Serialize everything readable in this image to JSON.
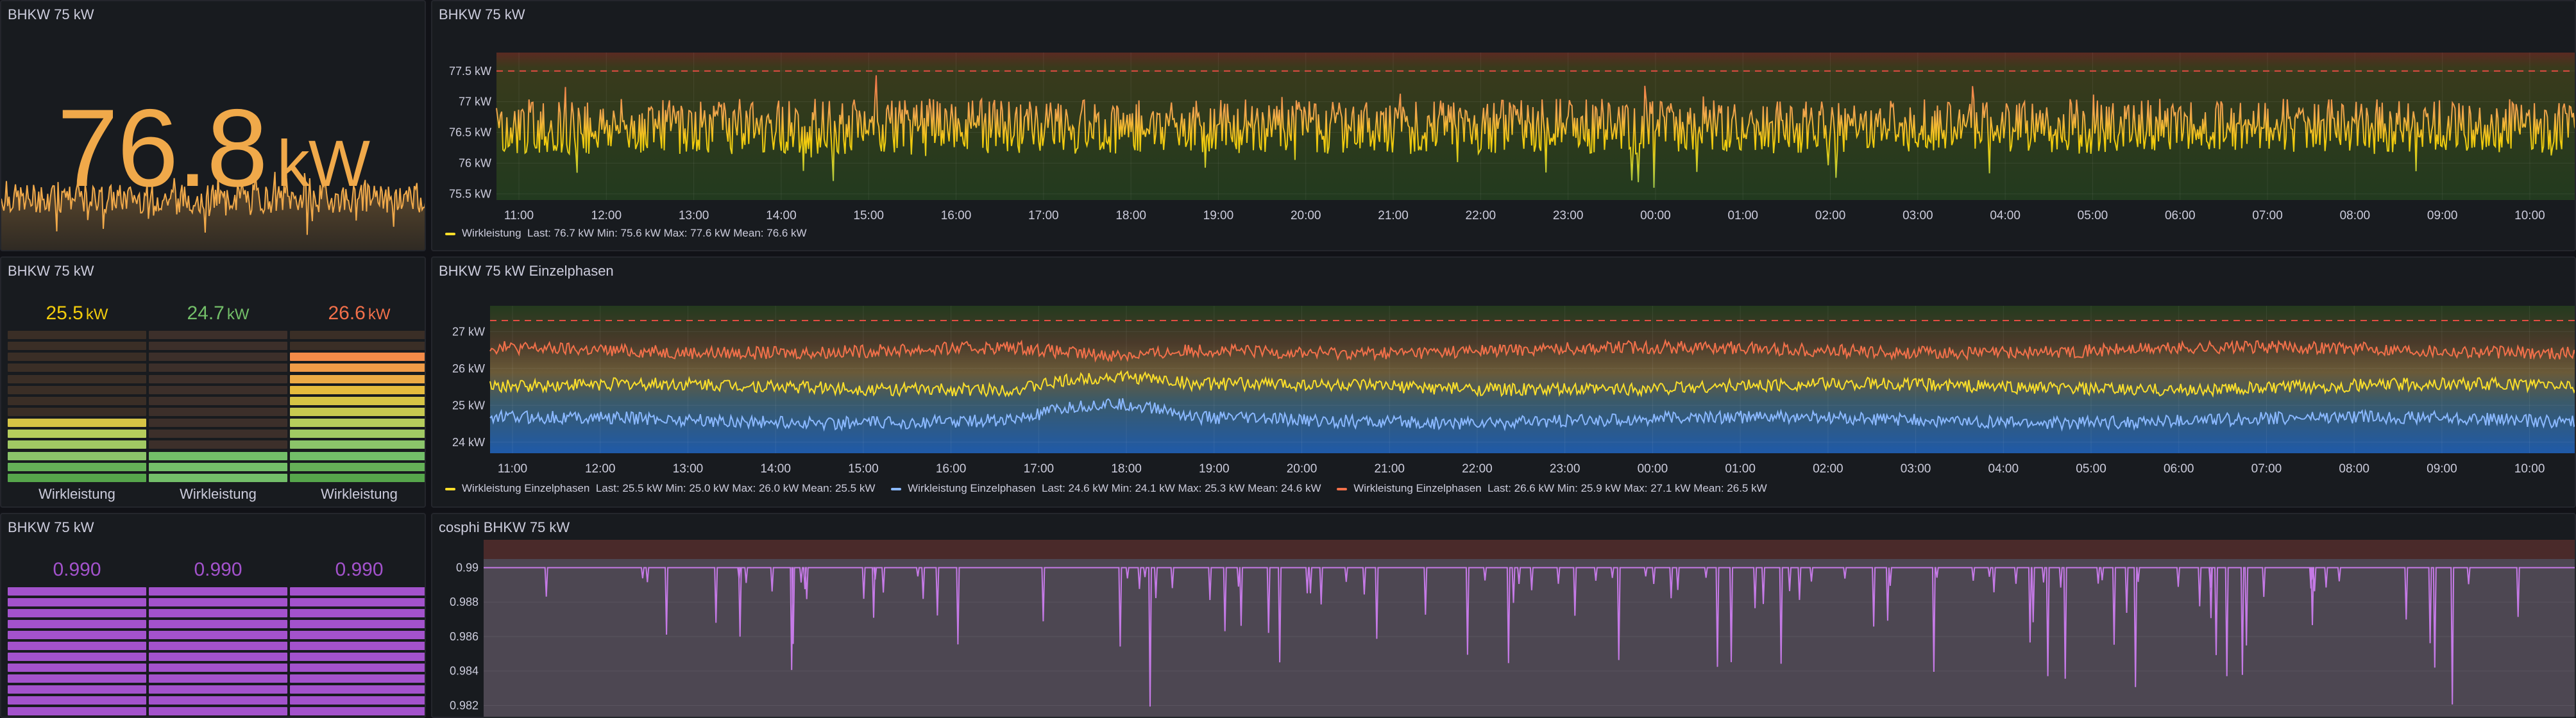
{
  "panels": {
    "stat": {
      "title": "BHKW 75 kW",
      "value": "76.8",
      "unit": "kW"
    },
    "power": {
      "title": "BHKW 75 kW",
      "y_ticks": [
        "77.5 kW",
        "77 kW",
        "76.5 kW",
        "76 kW",
        "75.5 kW"
      ],
      "x_ticks": [
        "11:00",
        "12:00",
        "13:00",
        "14:00",
        "15:00",
        "16:00",
        "17:00",
        "18:00",
        "19:00",
        "20:00",
        "21:00",
        "22:00",
        "23:00",
        "00:00",
        "01:00",
        "02:00",
        "03:00",
        "04:00",
        "05:00",
        "06:00",
        "07:00",
        "08:00",
        "09:00",
        "10:00"
      ],
      "legend": {
        "name": "Wirkleistung",
        "stats": "Last: 76.7 kW   Min: 75.6 kW   Max: 77.6 kW   Mean: 76.6 kW"
      }
    },
    "phases_bar": {
      "title": "BHKW 75 kW",
      "gauges": [
        {
          "value": "25.5",
          "unit": "kW",
          "label": "Wirkleistung",
          "color": "#f2cc0c"
        },
        {
          "value": "24.7",
          "unit": "kW",
          "label": "Wirkleistung",
          "color": "#73bf69"
        },
        {
          "value": "26.6",
          "unit": "kW",
          "label": "Wirkleistung",
          "color": "#f2704a"
        }
      ]
    },
    "phases": {
      "title": "BHKW 75 kW Einzelphasen",
      "y_ticks": [
        "27 kW",
        "26 kW",
        "25 kW",
        "24 kW"
      ],
      "x_ticks": [
        "11:00",
        "12:00",
        "13:00",
        "14:00",
        "15:00",
        "16:00",
        "17:00",
        "18:00",
        "19:00",
        "20:00",
        "21:00",
        "22:00",
        "23:00",
        "00:00",
        "01:00",
        "02:00",
        "03:00",
        "04:00",
        "05:00",
        "06:00",
        "07:00",
        "08:00",
        "09:00",
        "10:00"
      ],
      "legend": [
        {
          "name": "Wirkleistung Einzelphasen",
          "stats": "Last: 25.5 kW   Min: 25.0 kW   Max: 26.0 kW   Mean: 25.5 kW",
          "color": "#fade2a"
        },
        {
          "name": "Wirkleistung Einzelphasen",
          "stats": "Last: 24.6 kW   Min: 24.1 kW   Max: 25.3 kW   Mean: 24.6 kW",
          "color": "#8ab8ff"
        },
        {
          "name": "Wirkleistung Einzelphasen",
          "stats": "Last: 26.6 kW   Min: 25.9 kW   Max: 27.1 kW   Mean: 26.5 kW",
          "color": "#f2704a"
        }
      ]
    },
    "cosphi_bar": {
      "title": "BHKW 75 kW",
      "gauges": [
        {
          "value": "0.990",
          "color": "#a352cc"
        },
        {
          "value": "0.990",
          "color": "#a352cc"
        },
        {
          "value": "0.990",
          "color": "#a352cc"
        }
      ]
    },
    "cosphi": {
      "title": "cosphi BHKW 75 kW",
      "y_ticks": [
        "0.99",
        "0.988",
        "0.986",
        "0.984",
        "0.982"
      ]
    }
  },
  "chart_data": [
    {
      "type": "line",
      "title": "BHKW 75 kW",
      "series": [
        {
          "name": "Wirkleistung",
          "last": 76.7,
          "min": 75.6,
          "max": 77.6,
          "mean": 76.6
        }
      ],
      "ylim": [
        75.4,
        77.8
      ],
      "threshold": 77.5
    },
    {
      "type": "line",
      "title": "BHKW 75 kW Einzelphasen",
      "series": [
        {
          "name": "Wirkleistung Einzelphasen",
          "last": 25.5,
          "min": 25.0,
          "max": 26.0,
          "mean": 25.5
        },
        {
          "name": "Wirkleistung Einzelphasen",
          "last": 24.6,
          "min": 24.1,
          "max": 25.3,
          "mean": 24.6
        },
        {
          "name": "Wirkleistung Einzelphasen",
          "last": 26.6,
          "min": 25.9,
          "max": 27.1,
          "mean": 26.5
        }
      ],
      "ylim": [
        23.7,
        27.7
      ],
      "threshold": 27.3
    },
    {
      "type": "line",
      "title": "cosphi BHKW 75 kW",
      "series": [
        {
          "value": 0.99
        }
      ],
      "ylim": [
        0.9812,
        0.9905
      ]
    }
  ]
}
